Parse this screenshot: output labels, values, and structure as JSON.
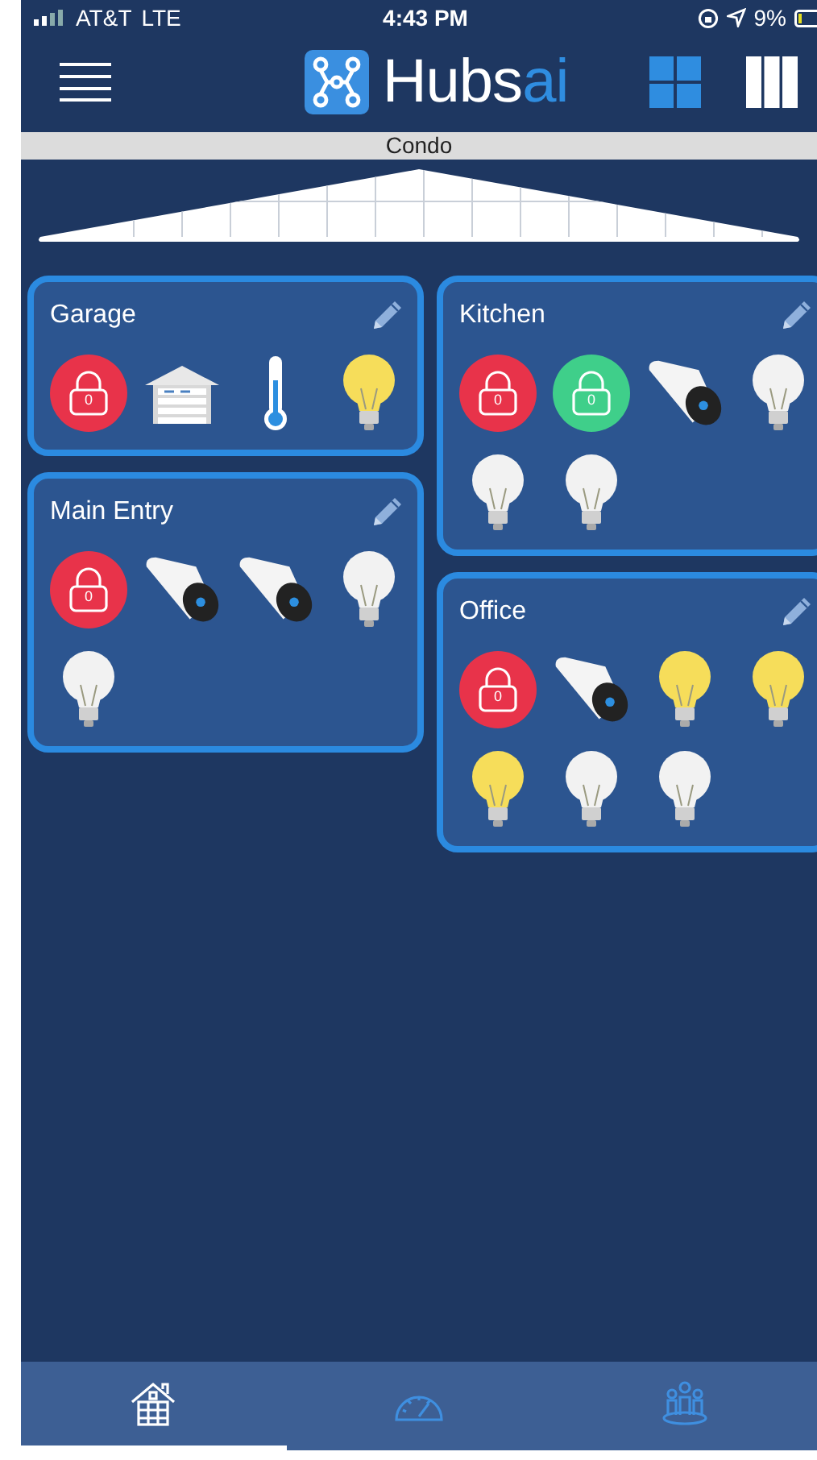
{
  "status_bar": {
    "carrier": "AT&T",
    "network": "LTE",
    "time": "4:43 PM",
    "battery": "9%"
  },
  "header": {
    "logo": {
      "name": "Hubs",
      "suffix": "ai"
    },
    "layout_options": [
      {
        "kind": "grid",
        "selected": true
      },
      {
        "kind": "columns",
        "selected": false
      }
    ]
  },
  "home": {
    "name": "Condo"
  },
  "rooms": [
    {
      "name": "Garage",
      "devices": [
        {
          "kind": "lock",
          "locked": true,
          "label": "0"
        },
        {
          "kind": "garage"
        },
        {
          "kind": "thermometer"
        },
        {
          "kind": "bulb",
          "on": true
        }
      ]
    },
    {
      "name": "Kitchen",
      "devices": [
        {
          "kind": "lock",
          "locked": true,
          "label": "0"
        },
        {
          "kind": "lock",
          "locked": false,
          "label": "0"
        },
        {
          "kind": "camera"
        },
        {
          "kind": "bulb",
          "on": false
        },
        {
          "kind": "bulb",
          "on": false
        },
        {
          "kind": "bulb",
          "on": false
        }
      ]
    },
    {
      "name": "Main Entry",
      "devices": [
        {
          "kind": "lock",
          "locked": true,
          "label": "0"
        },
        {
          "kind": "camera"
        },
        {
          "kind": "camera"
        },
        {
          "kind": "bulb",
          "on": false
        },
        {
          "kind": "bulb",
          "on": false
        }
      ]
    },
    {
      "name": "Office",
      "devices": [
        {
          "kind": "lock",
          "locked": true,
          "label": "0"
        },
        {
          "kind": "camera"
        },
        {
          "kind": "bulb",
          "on": true
        },
        {
          "kind": "bulb",
          "on": true
        },
        {
          "kind": "bulb",
          "on": true
        },
        {
          "kind": "bulb",
          "on": false
        },
        {
          "kind": "bulb",
          "on": false
        }
      ]
    }
  ],
  "tabs": [
    {
      "kind": "home",
      "selected": true
    },
    {
      "kind": "dashboard",
      "selected": false
    },
    {
      "kind": "people",
      "selected": false
    }
  ]
}
